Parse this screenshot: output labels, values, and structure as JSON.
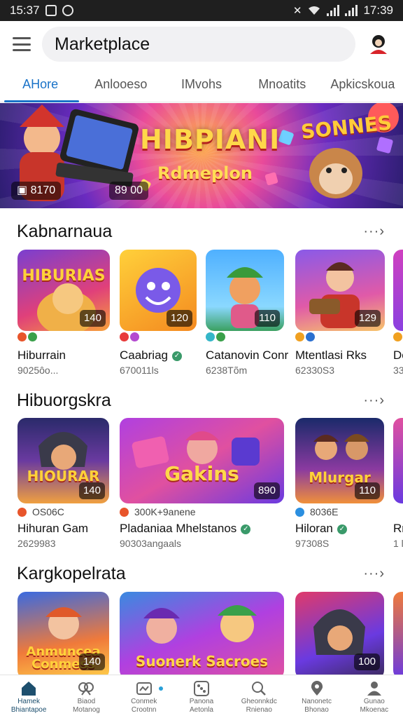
{
  "status_bar": {
    "time": "15:37",
    "right_time": "17:39"
  },
  "header": {
    "search_value": "Marketplace"
  },
  "tabs": [
    {
      "label": "AHore",
      "active": true
    },
    {
      "label": "Anlooeso",
      "active": false
    },
    {
      "label": "IMvohs",
      "active": false
    },
    {
      "label": "Mnoatits",
      "active": false
    },
    {
      "label": "Apkicskoua",
      "active": false
    }
  ],
  "banner": {
    "title": "HIBPIANI",
    "subtitle": "Rdmeplon",
    "right_text": "SONNES",
    "chip_left": "8170",
    "chip_right": "89 00"
  },
  "sections": [
    {
      "title": "Kabnarnaua",
      "more": "···›",
      "items": [
        {
          "name": "Hiburrain",
          "sub": "9025ôo...",
          "badge": "140",
          "art": "HIBURIAS",
          "verified": false,
          "dot_colors": [
            "#e8552b",
            "#3aa04a"
          ]
        },
        {
          "name": "Caabriag",
          "sub": "670011ls",
          "badge": "120",
          "art": "",
          "verified": true,
          "dot_colors": [
            "#e83b3b",
            "#b44ad0"
          ]
        },
        {
          "name": "Catanovin Conr",
          "sub": "6238Tõm",
          "badge": "110",
          "art": "",
          "verified": false,
          "dot_colors": [
            "#35b6c8",
            "#3aa04a"
          ]
        },
        {
          "name": "Mtentlasi Rks",
          "sub": "62330S3",
          "badge": "129",
          "art": "",
          "verified": false,
          "dot_colors": [
            "#f0a020",
            "#2b70d0"
          ]
        },
        {
          "name": "Do",
          "sub": "33",
          "badge": "",
          "art": "",
          "verified": false,
          "dot_colors": [
            "#f0a020"
          ]
        }
      ]
    },
    {
      "title": "Hibuorgskra",
      "more": "···›",
      "items": [
        {
          "name": "Hihuran Gam",
          "sub": "2629983",
          "badge": "140",
          "art": "HIOURAR",
          "meta": "OS06C",
          "verified": false,
          "dot_colors": [
            "#e8552b"
          ]
        },
        {
          "name": "Pladaniaa Mhelstanos",
          "sub": "90303angaals",
          "badge": "890",
          "art": "Gakins",
          "meta": "300K+9anene",
          "verified": true,
          "dot_colors": [
            "#e8552b"
          ]
        },
        {
          "name": "Hiloran",
          "sub": "97308S",
          "badge": "110",
          "art": "Mlurgar",
          "meta": "8036E",
          "verified": true,
          "dot_colors": [
            "#2b8fe0"
          ]
        },
        {
          "name": "Rr",
          "sub": "1 l",
          "badge": "",
          "art": "",
          "meta": "",
          "verified": false,
          "dot_colors": []
        }
      ]
    },
    {
      "title": "Kargkopelrata",
      "more": "···›",
      "items": [
        {
          "name": "",
          "sub": "",
          "badge": "140",
          "art": "Anmuncea Conmess",
          "verified": false,
          "dot_colors": []
        },
        {
          "name": "",
          "sub": "",
          "badge": "",
          "art": "Suonerk Sacroes",
          "verified": false,
          "dot_colors": []
        },
        {
          "name": "",
          "sub": "",
          "badge": "100",
          "art": "",
          "verified": false,
          "dot_colors": []
        }
      ]
    }
  ],
  "bottom_nav": [
    {
      "icon": "home-icon",
      "label1": "Hamek",
      "label2": "Bhiantapoe",
      "active": true
    },
    {
      "icon": "pretzel-icon",
      "label1": "Biaod",
      "label2": "Motanog",
      "active": false
    },
    {
      "icon": "gamepad-icon",
      "label1": "Conmek",
      "label2": "Crootnn",
      "active": false
    },
    {
      "icon": "dice-icon",
      "label1": "Panona",
      "label2": "Aetonla",
      "active": false
    },
    {
      "icon": "search-icon",
      "label1": "Gheonnkdc",
      "label2": "Rnienao",
      "active": false
    },
    {
      "icon": "pin-icon",
      "label1": "Nanonetc",
      "label2": "Bhonao",
      "active": false
    },
    {
      "icon": "profile-icon",
      "label1": "Gunao",
      "label2": "Mkoenac",
      "active": false
    }
  ],
  "colors": {
    "accent": "#1a73c8",
    "nav_active": "#1d4f6e"
  }
}
